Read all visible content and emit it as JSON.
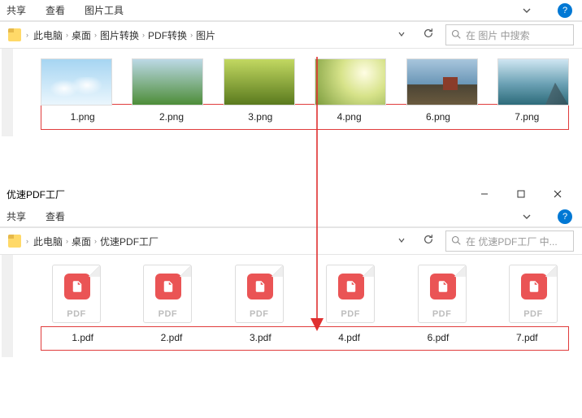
{
  "top": {
    "tabs": [
      "共享",
      "查看",
      "图片工具"
    ],
    "breadcrumb": [
      "此电脑",
      "桌面",
      "图片转换",
      "PDF转换",
      "图片"
    ],
    "search_placeholder": "在 图片 中搜索",
    "files": [
      {
        "name": "1.png"
      },
      {
        "name": "2.png"
      },
      {
        "name": "3.png"
      },
      {
        "name": "4.png"
      },
      {
        "name": "6.png"
      },
      {
        "name": "7.png"
      }
    ]
  },
  "bottom": {
    "title": "优速PDF工厂",
    "tabs": [
      "共享",
      "查看"
    ],
    "breadcrumb": [
      "此电脑",
      "桌面",
      "优速PDF工厂"
    ],
    "search_placeholder": "在 优速PDF工厂 中...",
    "pdf_label": "PDF",
    "files": [
      {
        "name": "1.pdf"
      },
      {
        "name": "2.pdf"
      },
      {
        "name": "3.pdf"
      },
      {
        "name": "4.pdf"
      },
      {
        "name": "6.pdf"
      },
      {
        "name": "7.pdf"
      }
    ]
  },
  "help_label": "?"
}
